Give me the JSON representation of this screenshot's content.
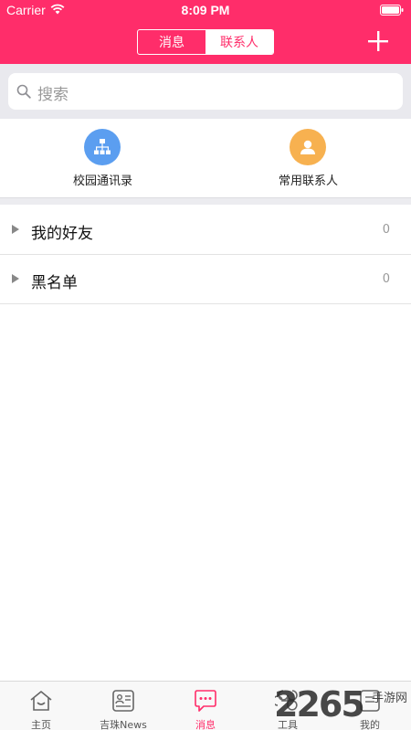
{
  "status_bar": {
    "carrier": "Carrier",
    "time": "8:09 PM"
  },
  "header": {
    "tabs": [
      {
        "label": "消息"
      },
      {
        "label": "联系人"
      }
    ],
    "active_tab": 1,
    "add_icon": "plus-icon",
    "accent_color": "#ff2d6a"
  },
  "search": {
    "placeholder": "搜索"
  },
  "quick_links": [
    {
      "label": "校园通讯录",
      "icon": "org-chart-icon",
      "color": "#5b9ef0"
    },
    {
      "label": "常用联系人",
      "icon": "person-icon",
      "color": "#f7b150"
    }
  ],
  "groups": [
    {
      "label": "我的好友",
      "count": "0"
    },
    {
      "label": "黑名单",
      "count": "0"
    }
  ],
  "tabbar": {
    "items": [
      {
        "label": "主页",
        "icon": "home-icon"
      },
      {
        "label": "吉珠News",
        "icon": "news-icon"
      },
      {
        "label": "消息",
        "icon": "chat-icon"
      },
      {
        "label": "工具",
        "icon": "tools-icon"
      },
      {
        "label": "我的",
        "icon": "profile-icon"
      }
    ],
    "active_index": 2
  },
  "watermark": {
    "number": "2265",
    "domain": "手游网"
  }
}
